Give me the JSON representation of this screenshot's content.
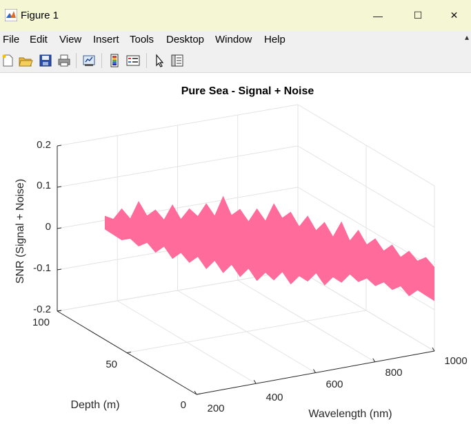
{
  "window": {
    "title": "Figure 1",
    "controls": {
      "minimize": "—",
      "maximize": "☐",
      "close": "✕"
    }
  },
  "menu": {
    "items": [
      "File",
      "Edit",
      "View",
      "Insert",
      "Tools",
      "Desktop",
      "Window",
      "Help"
    ],
    "overflow_icon": "arrow-icon"
  },
  "toolbar": {
    "buttons": [
      "new-figure",
      "open-file",
      "save",
      "print",
      "link-plot",
      "insert-colorbar",
      "insert-legend",
      "edit-plot",
      "property-inspector"
    ]
  },
  "chart_data": {
    "type": "surface",
    "title": "Pure Sea - Signal + Noise",
    "xlabel": "Wavelength (nm)",
    "ylabel": "Depth (m)",
    "zlabel": "SNR (Signal + Noise)",
    "x_ticks": [
      "200",
      "400",
      "600",
      "800",
      "1000"
    ],
    "y_ticks": [
      "0",
      "50",
      "100"
    ],
    "z_ticks": [
      "-0.2",
      "-0.1",
      "0",
      "0.1",
      "0.2"
    ],
    "xlim": [
      200,
      1000
    ],
    "ylim": [
      0,
      100
    ],
    "zlim": [
      -0.2,
      0.2
    ],
    "grid": true,
    "surface_color": "#ff6b9a",
    "description_values": {
      "upper_edge_samples": [
        0.05,
        0.04,
        0.09,
        0.05,
        0.13,
        0.07,
        0.1,
        0.06,
        0.13,
        0.07,
        0.12,
        0.09,
        0.15,
        0.1,
        0.19,
        0.11,
        0.14,
        0.09,
        0.15,
        0.1,
        0.18,
        0.12,
        0.15,
        0.09,
        0.14,
        0.08,
        0.12,
        0.06,
        0.13,
        0.05,
        0.1,
        0.04,
        0.07,
        0.02,
        0.05,
        0.0,
        0.03,
        -0.01,
        0.01,
        -0.03
      ],
      "lower_edge_samples": [
        -0.01,
        -0.03,
        -0.05,
        -0.04,
        -0.07,
        -0.05,
        -0.09,
        -0.06,
        -0.11,
        -0.08,
        -0.12,
        -0.09,
        -0.14,
        -0.1,
        -0.15,
        -0.11,
        -0.16,
        -0.12,
        -0.17,
        -0.13,
        -0.16,
        -0.12,
        -0.17,
        -0.13,
        -0.15,
        -0.11,
        -0.16,
        -0.12,
        -0.14,
        -0.1,
        -0.13,
        -0.11,
        -0.14,
        -0.12,
        -0.15,
        -0.13,
        -0.17,
        -0.14,
        -0.16,
        -0.18
      ]
    }
  }
}
